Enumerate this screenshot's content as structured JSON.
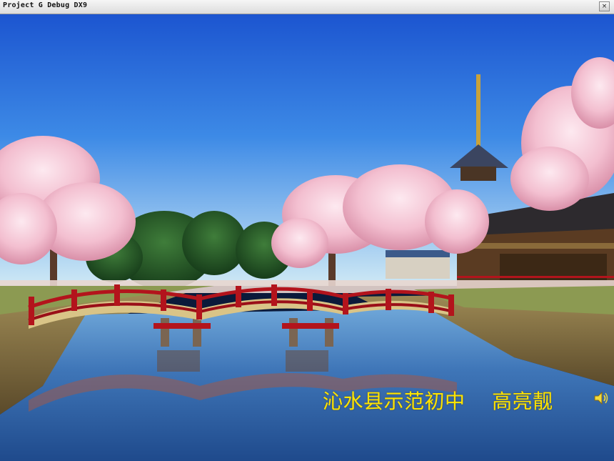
{
  "window": {
    "title": "Project G Debug DX9",
    "close_glyph": "×"
  },
  "scene": {
    "description_icons": [
      "cherry-blossom-trees",
      "red-arched-bridge",
      "pagoda",
      "temple-building",
      "river"
    ]
  },
  "caption": {
    "text": "沁水县示范初中    高亮靓"
  },
  "colors": {
    "caption": "#ffe400",
    "sky_top": "#1f5fd6",
    "sky_bottom": "#bfe2f4",
    "bridge_red": "#b3141c",
    "blossom": "#f4c6d6",
    "water": "#2f5fa8"
  },
  "icons": {
    "speaker": "speaker-icon",
    "close": "close-icon",
    "app": "app-icon"
  }
}
